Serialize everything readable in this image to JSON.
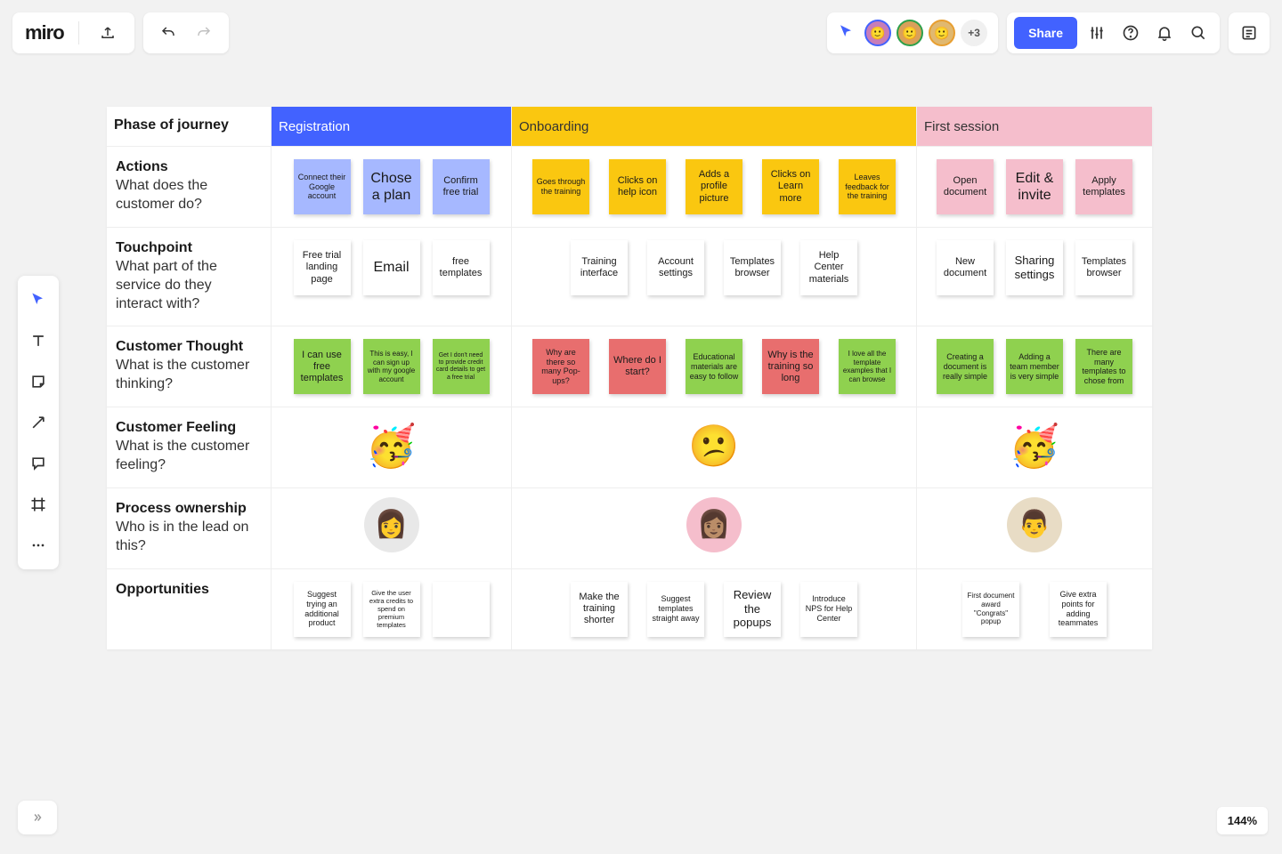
{
  "header": {
    "logo": "miro",
    "plus_count": "+3",
    "share": "Share"
  },
  "zoom": "144%",
  "journey": {
    "phase_label": "Phase of journey",
    "phases": [
      "Registration",
      "Onboarding",
      "First session"
    ],
    "rows": [
      {
        "title": "Actions",
        "desc": "What does the customer do?"
      },
      {
        "title": "Touchpoint",
        "desc": "What part of the service do they interact with?"
      },
      {
        "title": "Customer Thought",
        "desc": "What is the customer thinking?"
      },
      {
        "title": "Customer Feeling",
        "desc": "What is the customer feeling?"
      },
      {
        "title": "Process ownership",
        "desc": "Who is in the lead on this?"
      },
      {
        "title": "Opportunities",
        "desc": ""
      }
    ],
    "actions": {
      "reg": [
        "Connect their Google account",
        "Chose a plan",
        "Confirm free trial"
      ],
      "onb": [
        "Goes through the training",
        "Clicks on help icon",
        "Adds a profile picture",
        "Clicks on Learn more",
        "Leaves feedback for the training"
      ],
      "first": [
        "Open document",
        "Edit & invite",
        "Apply templates"
      ]
    },
    "touch": {
      "reg": [
        "Free trial landing page",
        "Email",
        "free templates"
      ],
      "onb": [
        "Training interface",
        "Account settings",
        "Templates browser",
        "Help Center materials"
      ],
      "first": [
        "New document",
        "Sharing settings",
        "Templates browser"
      ]
    },
    "thought": {
      "reg": [
        "I can use free templates",
        "This is easy, I can sign up with my google account",
        "Get I don't need to provide credit card details to get a free trial"
      ],
      "onb": [
        "Why are there so many Pop-ups?",
        "Where do I start?",
        "Educational materials are easy to follow",
        "Why is the training so long",
        "I love all the template examples that I can browse"
      ],
      "first": [
        "Creating a document is really simple",
        "Adding a team member is very simple",
        "There are many templates to chose from"
      ]
    },
    "feeling": {
      "reg": "🥳",
      "onb": "😕",
      "first": "🥳"
    },
    "opp": {
      "reg": [
        "Suggest trying an additional product",
        "Give the user extra credits to spend on premium templates",
        ""
      ],
      "onb": [
        "Make the training shorter",
        "Suggest templates straight away",
        "Review the popups",
        "Introduce NPS for Help Center"
      ],
      "first": [
        "First document award \"Congrats\" popup",
        "Give extra points for adding teammates"
      ]
    }
  }
}
